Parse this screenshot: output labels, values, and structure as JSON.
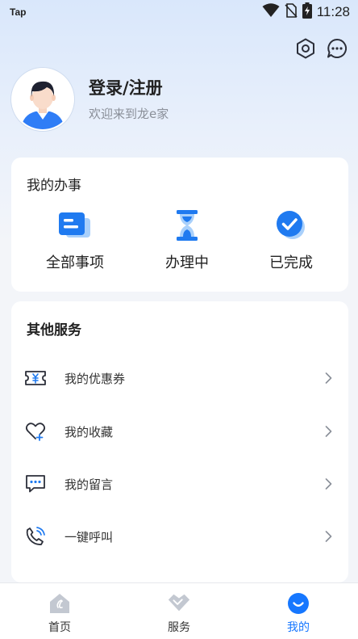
{
  "status_bar": {
    "carrier": "Tap",
    "time": "11:28"
  },
  "top_icons": [
    "settings-icon",
    "message-icon"
  ],
  "profile": {
    "title": "登录/注册",
    "subtitle": "欢迎来到龙e家"
  },
  "affairs": {
    "title": "我的办事",
    "items": [
      {
        "label": "全部事项",
        "icon": "all-items-icon"
      },
      {
        "label": "办理中",
        "icon": "hourglass-icon"
      },
      {
        "label": "已完成",
        "icon": "completed-check-icon"
      }
    ]
  },
  "services": {
    "title": "其他服务",
    "items": [
      {
        "label": "我的优惠券",
        "icon": "coupon-icon"
      },
      {
        "label": "我的收藏",
        "icon": "favorite-heart-icon"
      },
      {
        "label": "我的留言",
        "icon": "comment-icon"
      },
      {
        "label": "一键呼叫",
        "icon": "phone-call-icon"
      }
    ]
  },
  "tab_bar": {
    "tabs": [
      {
        "label": "首页",
        "icon": "home-icon",
        "active": false
      },
      {
        "label": "服务",
        "icon": "service-icon",
        "active": false
      },
      {
        "label": "我的",
        "icon": "profile-icon",
        "active": true
      }
    ]
  },
  "colors": {
    "accent": "#1677ff",
    "icon_dark": "#2c2f3a"
  }
}
